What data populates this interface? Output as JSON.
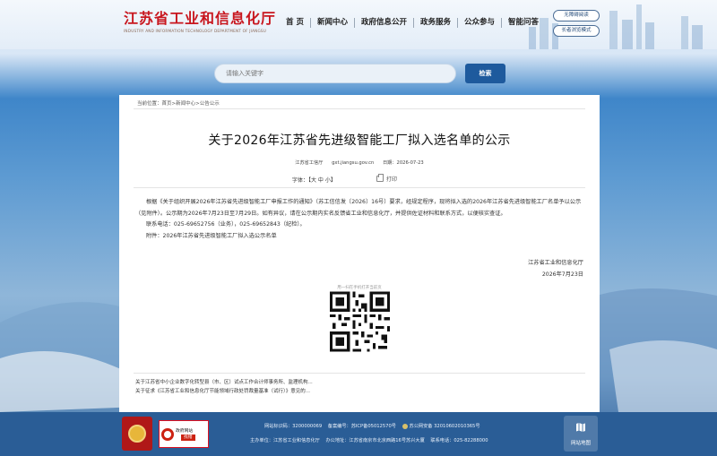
{
  "header": {
    "logo_title": "江苏省工业和信息化厅",
    "logo_subtitle": "INDUSTRY AND INFORMATION TECHNOLOGY DEPARTMENT OF JIANGSU",
    "nav": [
      "首 页",
      "新闻中心",
      "政府信息公开",
      "政务服务",
      "公众参与",
      "智能问答"
    ],
    "accessibility_label": "无障碍阅读",
    "elder_mode_label": "长者浏览模式"
  },
  "search": {
    "placeholder": "请输入关键字",
    "button_label": "检索"
  },
  "breadcrumb": {
    "prefix": "当前位置：",
    "path": "首页>新闻中心>公告公示"
  },
  "article": {
    "title": "关于2026年江苏省先进级智能工厂拟入选名单的公示",
    "source": "江苏省工信厅",
    "domain": "gxt.jiangsu.gov.cn",
    "date": "日期：2026-07-23",
    "font_size_label": "字体：【大  中  小】",
    "print_label": "打印",
    "paragraph1": "根据《关于组织开展2026年江苏省先进级智能工厂申报工作的通知》（苏工信信发〔2026〕16号）要求，经规定程序，现将拟入选的2026年江苏省先进级智能工厂名单予以公示（见附件）。公示期为2026年7月23日至7月29日。如有异议，请在公示期内实名反馈省工业和信息化厅，并提供佐证材料和联系方式，以便核实查证。",
    "contact": "联系电话：025-69652756（业务），025-69652843（纪检）。",
    "attachment": "附件：2026年江苏省先进级智能工厂拟入选公示名单",
    "sign_org": "江苏省工业和信息化厅",
    "sign_date": "2026年7月23日",
    "qr_caption": "用一扫在手机打开当前页"
  },
  "related": [
    "关于江苏省中小企业数字化转型县（市、区）试点工作合计师事务所、监理机构...",
    "关于征求《江苏省工业和信息化厅节能领域行政处罚裁量基准（试行）》意见的..."
  ],
  "footer": {
    "error_title": "政府网站",
    "error_button": "找错",
    "site_code": "网站标识码：3200000069",
    "icp": "备案编号：苏ICP备05012570号",
    "police": "苏公网安备 32010602010365号",
    "host": "主办单位：江苏省工业和信息化厅",
    "address": "办公地址：江苏省南京市北京西路16号苏兴大厦",
    "phone": "联系电话：025-82288000",
    "sitemap_label": "网站地图"
  }
}
